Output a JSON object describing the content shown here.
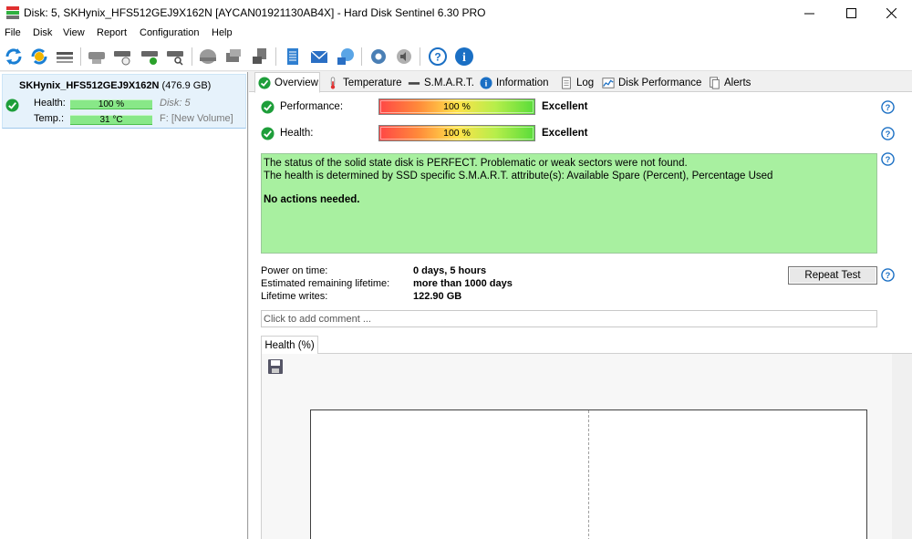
{
  "window": {
    "title": "Disk: 5, SKHynix_HFS512GEJ9X162N [AYCAN01921130AB4X]  -  Hard Disk Sentinel 6.30 PRO"
  },
  "menu": [
    "File",
    "Disk",
    "View",
    "Report",
    "Configuration",
    "Help"
  ],
  "toolbar_icons": [
    "refresh-icon",
    "refresh-all-icon",
    "disk-list-icon",
    "disk-gray-icon",
    "disk-schedule-icon",
    "disk-check-icon",
    "disk-search-icon",
    "disk-dome-icon",
    "disk-export-icon",
    "disk-usb-icon",
    "report-icon",
    "email-icon",
    "network-icon",
    "settings-icon",
    "sound-icon",
    "help-icon",
    "info-icon"
  ],
  "sidebar": {
    "disk_name": "SKHynix_HFS512GEJ9X162N",
    "disk_size": "(476.9 GB)",
    "health_label": "Health:",
    "health_value": "100 %",
    "temp_label": "Temp.:",
    "temp_value": "31 °C",
    "disk_number": "Disk: 5",
    "volume": "F: [New Volume]"
  },
  "tabs": [
    "Overview",
    "Temperature",
    "S.M.A.R.T.",
    "Information",
    "Log",
    "Disk Performance",
    "Alerts"
  ],
  "overview": {
    "performance_label": "Performance:",
    "performance_value": "100 %",
    "performance_rating": "Excellent",
    "health_label": "Health:",
    "health_value": "100 %",
    "health_rating": "Excellent",
    "status_line1": "The status of the solid state disk is PERFECT. Problematic or weak sectors were not found.",
    "status_line2": "The health is determined by SSD specific S.M.A.R.T. attribute(s):  Available Spare (Percent), Percentage Used",
    "status_action": "No actions needed.",
    "power_on_label": "Power on time:",
    "power_on_value": "0 days, 5 hours",
    "lifetime_label": "Estimated remaining lifetime:",
    "lifetime_value": "more than 1000 days",
    "writes_label": "Lifetime writes:",
    "writes_value": "122.90 GB",
    "repeat_test_label": "Repeat Test",
    "comment_placeholder": "Click to add comment ..."
  },
  "health_chart": {
    "tab_label": "Health (%)"
  },
  "colors": {
    "status_bg": "#a8f0a0",
    "ok_green": "#1e9e3a",
    "help_blue": "#1a6fc4",
    "selection_bg": "#e6f2fb"
  }
}
